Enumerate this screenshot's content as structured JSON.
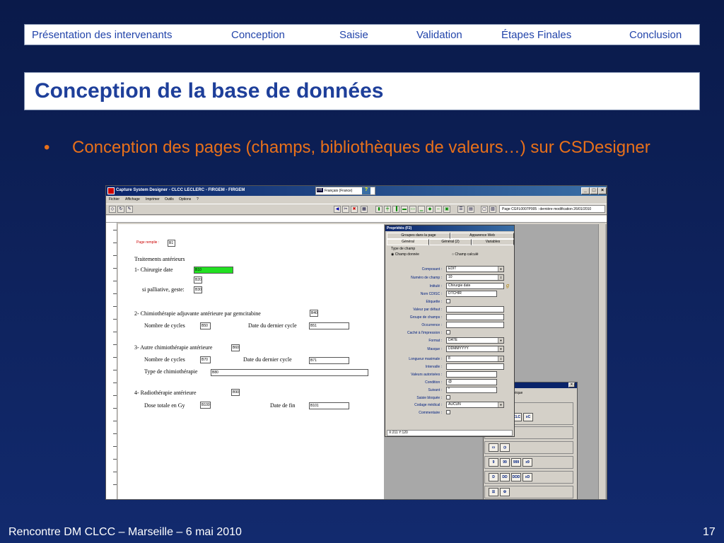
{
  "nav": {
    "items": [
      "Présentation des intervenants",
      "Conception",
      "Saisie",
      "Validation",
      "Étapes Finales",
      "Conclusion"
    ]
  },
  "slide": {
    "title": "Conception de la base de données",
    "bullet_dot": "•",
    "bullet_text": "Conception des pages (champs, bibliothèques de valeurs…) sur CSDesigner"
  },
  "footer": {
    "left": "Rencontre DM CLCC – Marseille – 6 mai 2010",
    "page_number": "17"
  },
  "app": {
    "title": "Capture System Designer - CLCC LECLERC - FIRGEM - FIRGEM",
    "lang_code": "FR",
    "lang_label": "Français (France)",
    "minimize": "_",
    "maximize": "□",
    "close": "×",
    "menu": [
      "Fichier",
      "Affichage",
      "Imprimer",
      "Outils",
      "Options",
      "?"
    ],
    "page_info": "Page CGFL0007P005 : dernière modification 26/01/2010",
    "form": {
      "page_label": "Page remplie :",
      "page_field": "B1",
      "section_title": "Traitements antérieurs",
      "q1_label": "1- Chirurgie date",
      "q1_field": "B10",
      "q1b_field": "B20",
      "q1c_label": "si palliative, geste:",
      "q1c_field": "B30",
      "q2_label": "2- Chimiothérapie adjuvante antérieure par gemcitabine",
      "q2_field": "B40",
      "q2_cycles_label": "Nombre de cycles",
      "q2_cycles_field": "B50",
      "q2_date_label": "Date du dernier cycle",
      "q2_date_field": "B51",
      "q3_label": "3- Autre chimiothérapie antérieure",
      "q3_field": "B60",
      "q3_cycles_label": "Nombre de cycles",
      "q3_cycles_field": "B70",
      "q3_date_label": "Date du dernier cycle",
      "q3_date_field": "B71",
      "q3_type_label": "Type de chimiothérapie",
      "q3_type_field": "B80",
      "q4_label": "4- Radiothérapie antérieure",
      "q4_field": "B90",
      "q4_dose_label": "Dose totale en Gy",
      "q4_dose_field": "B100",
      "q4_date_label": "Date de fin",
      "q4_date_field": "B101"
    },
    "properties": {
      "title": "Propriétés (F2)",
      "tabs_row1": [
        "Groupes dans la page",
        "Apparence Web"
      ],
      "tabs_row2": [
        "Général",
        "Général (2)",
        "Variables"
      ],
      "type_group": "Type de champ",
      "radio_data": "Champ donnée",
      "radio_calc": "Champ calculé",
      "fields": [
        {
          "label": "Composant :",
          "value": "EDIT",
          "kind": "select"
        },
        {
          "label": "Numéro de champ :",
          "value": "10",
          "kind": "spin"
        },
        {
          "label": "Intitulé :",
          "value": "Chirurgie date",
          "kind": "text"
        },
        {
          "label": "Nom CDISC :",
          "value": "DTCHIR",
          "kind": "text"
        },
        {
          "label": "Etiquette :",
          "value": "",
          "kind": "check"
        },
        {
          "label": "Valeur par défaut :",
          "value": "",
          "kind": "text"
        },
        {
          "label": "Groupe de champs :",
          "value": "",
          "kind": "text"
        },
        {
          "label": "Occurrence :",
          "value": "",
          "kind": "text"
        },
        {
          "label": "Caché à l'impression :",
          "value": "",
          "kind": "check"
        },
        {
          "label": "Format :",
          "value": "DATE",
          "kind": "select"
        },
        {
          "label": "Masque :",
          "value": "DDMMYYYY",
          "kind": "select"
        },
        {
          "label": "Longueur maximale :",
          "value": "8",
          "kind": "spin"
        },
        {
          "label": "Intervalle :",
          "value": "",
          "kind": "text"
        },
        {
          "label": "Valeurs autorisées :",
          "value": "",
          "kind": "text"
        },
        {
          "label": "Condition :",
          "value": "@",
          "kind": "text"
        },
        {
          "label": "Suivant :",
          "value": "*",
          "kind": "text"
        },
        {
          "label": "Saisie bloquée :",
          "value": "",
          "kind": "check"
        },
        {
          "label": "Codage médical :",
          "value": "AUCUN",
          "kind": "select"
        },
        {
          "label": "Commentaire :",
          "value": "",
          "kind": "check"
        }
      ],
      "status": "X:211 Y:120"
    },
    "palette": {
      "tab_label": "thèque",
      "row_clc": [
        "CLC",
        "xC"
      ],
      "row_num": [
        "9",
        "99",
        "999",
        "x9"
      ],
      "row_d": [
        "D",
        "DD",
        "DDD",
        "xD"
      ]
    }
  }
}
